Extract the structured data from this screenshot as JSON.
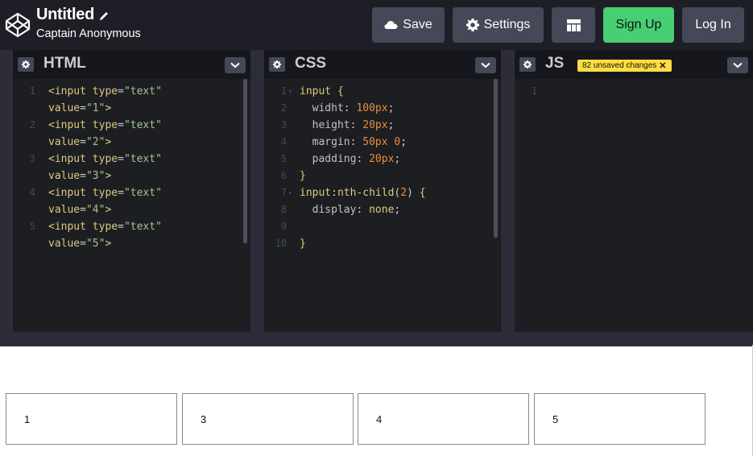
{
  "header": {
    "title": "Untitled",
    "author": "Captain Anonymous",
    "buttons": {
      "save": "Save",
      "settings": "Settings",
      "signup": "Sign Up",
      "login": "Log In"
    },
    "icons": [
      "codepen-logo-icon",
      "pencil-icon",
      "cloud-icon",
      "gear-icon",
      "layout-icon"
    ]
  },
  "editors": {
    "html": {
      "title": "HTML",
      "lines": [
        {
          "num": "1",
          "segments": [
            {
              "t": "<input ",
              "c": "t-tag"
            },
            {
              "t": "type",
              "c": "t-attr"
            },
            {
              "t": "=",
              "c": "t-plain"
            },
            {
              "t": "\"text\"",
              "c": "t-str"
            }
          ]
        },
        {
          "num": "",
          "segments": [
            {
              "t": "value",
              "c": "t-attr"
            },
            {
              "t": "=",
              "c": "t-plain"
            },
            {
              "t": "\"1\"",
              "c": "t-str"
            },
            {
              "t": ">",
              "c": "t-tag"
            }
          ]
        },
        {
          "num": "2",
          "segments": [
            {
              "t": "<input ",
              "c": "t-tag"
            },
            {
              "t": "type",
              "c": "t-attr"
            },
            {
              "t": "=",
              "c": "t-plain"
            },
            {
              "t": "\"text\"",
              "c": "t-str"
            }
          ]
        },
        {
          "num": "",
          "segments": [
            {
              "t": "value",
              "c": "t-attr"
            },
            {
              "t": "=",
              "c": "t-plain"
            },
            {
              "t": "\"2\"",
              "c": "t-str"
            },
            {
              "t": ">",
              "c": "t-tag"
            }
          ]
        },
        {
          "num": "3",
          "segments": [
            {
              "t": "<input ",
              "c": "t-tag"
            },
            {
              "t": "type",
              "c": "t-attr"
            },
            {
              "t": "=",
              "c": "t-plain"
            },
            {
              "t": "\"text\"",
              "c": "t-str"
            }
          ]
        },
        {
          "num": "",
          "segments": [
            {
              "t": "value",
              "c": "t-attr"
            },
            {
              "t": "=",
              "c": "t-plain"
            },
            {
              "t": "\"3\"",
              "c": "t-str"
            },
            {
              "t": ">",
              "c": "t-tag"
            }
          ]
        },
        {
          "num": "4",
          "segments": [
            {
              "t": "<input ",
              "c": "t-tag"
            },
            {
              "t": "type",
              "c": "t-attr"
            },
            {
              "t": "=",
              "c": "t-plain"
            },
            {
              "t": "\"text\"",
              "c": "t-str"
            }
          ]
        },
        {
          "num": "",
          "segments": [
            {
              "t": "value",
              "c": "t-attr"
            },
            {
              "t": "=",
              "c": "t-plain"
            },
            {
              "t": "\"4\"",
              "c": "t-str"
            },
            {
              "t": ">",
              "c": "t-tag"
            }
          ]
        },
        {
          "num": "5",
          "segments": [
            {
              "t": "<input ",
              "c": "t-tag"
            },
            {
              "t": "type",
              "c": "t-attr"
            },
            {
              "t": "=",
              "c": "t-plain"
            },
            {
              "t": "\"text\"",
              "c": "t-str"
            }
          ]
        },
        {
          "num": "",
          "segments": [
            {
              "t": "value",
              "c": "t-attr"
            },
            {
              "t": "=",
              "c": "t-plain"
            },
            {
              "t": "\"5\"",
              "c": "t-str"
            },
            {
              "t": ">",
              "c": "t-tag"
            }
          ]
        }
      ]
    },
    "css": {
      "title": "CSS",
      "lines": [
        {
          "num": "1",
          "fold": true,
          "segments": [
            {
              "t": "input ",
              "c": "t-sel"
            },
            {
              "t": "{",
              "c": "t-brace"
            }
          ]
        },
        {
          "num": "2",
          "segments": [
            {
              "t": "  widht",
              "c": "t-prop"
            },
            {
              "t": ": ",
              "c": "t-plain"
            },
            {
              "t": "100px",
              "c": "t-num"
            },
            {
              "t": ";",
              "c": "t-plain"
            }
          ]
        },
        {
          "num": "3",
          "segments": [
            {
              "t": "  height",
              "c": "t-prop"
            },
            {
              "t": ": ",
              "c": "t-plain"
            },
            {
              "t": "20px",
              "c": "t-num"
            },
            {
              "t": ";",
              "c": "t-plain"
            }
          ]
        },
        {
          "num": "4",
          "segments": [
            {
              "t": "  margin",
              "c": "t-prop"
            },
            {
              "t": ": ",
              "c": "t-plain"
            },
            {
              "t": "50px 0",
              "c": "t-num"
            },
            {
              "t": ";",
              "c": "t-plain"
            }
          ]
        },
        {
          "num": "5",
          "segments": [
            {
              "t": "  padding",
              "c": "t-prop"
            },
            {
              "t": ": ",
              "c": "t-plain"
            },
            {
              "t": "20px",
              "c": "t-num"
            },
            {
              "t": ";",
              "c": "t-plain"
            }
          ]
        },
        {
          "num": "6",
          "segments": [
            {
              "t": "}",
              "c": "t-brace"
            }
          ]
        },
        {
          "num": "7",
          "fold": true,
          "segments": [
            {
              "t": "input:nth-child",
              "c": "t-sel"
            },
            {
              "t": "(",
              "c": "t-plain"
            },
            {
              "t": "2",
              "c": "t-num"
            },
            {
              "t": ") ",
              "c": "t-plain"
            },
            {
              "t": "{",
              "c": "t-brace"
            }
          ]
        },
        {
          "num": "8",
          "segments": [
            {
              "t": "  display",
              "c": "t-prop"
            },
            {
              "t": ": ",
              "c": "t-plain"
            },
            {
              "t": "none",
              "c": "t-sel"
            },
            {
              "t": ";",
              "c": "t-plain"
            }
          ]
        },
        {
          "num": "9",
          "segments": []
        },
        {
          "num": "10",
          "segments": [
            {
              "t": "}",
              "c": "t-brace"
            }
          ]
        }
      ]
    },
    "js": {
      "title": "JS",
      "badge": "82 unsaved changes",
      "badge_close": "✕",
      "lines": [
        {
          "num": "1",
          "segments": []
        }
      ]
    }
  },
  "preview": {
    "inputs": [
      "1",
      "3",
      "4",
      "5"
    ]
  },
  "colors": {
    "header_bg": "#1e1f26",
    "button_bg": "#444857",
    "signup_bg": "#47cf73",
    "editor_bg": "#1d1e22",
    "badge_bg": "#ffdd40"
  }
}
